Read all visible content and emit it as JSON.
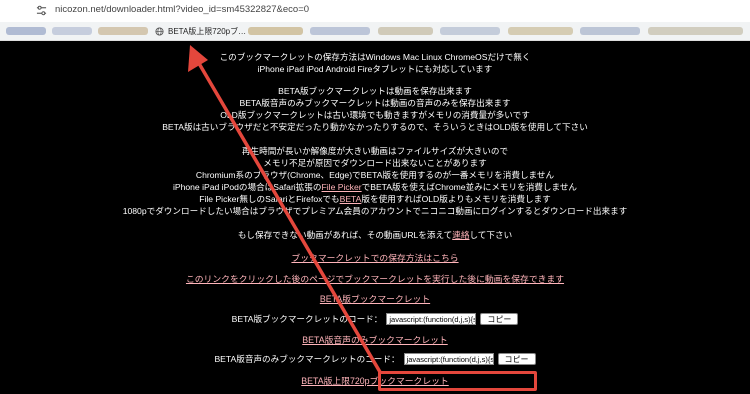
{
  "browser": {
    "url": "nicozon.net/downloader.html?video_id=sm45322827&eco=0",
    "active_bookmark": "BETA版上限720pブ…"
  },
  "page": {
    "intro": [
      "このブックマークレットの保存方法はWindows Mac Linux ChromeOSだけで無く",
      "iPhone iPad iPod Android Fireタブレットにも対応しています"
    ],
    "versions": [
      "BETA版ブックマークレットは動画を保存出来ます",
      "BETA版音声のみブックマークレットは動画の音声のみを保存出来ます",
      "OLD版ブックマークレットは古い環境でも動きますがメモリの消費量が多いです",
      "BETA版は古いブラウザだと不安定だったり動かなかったりするので、そういうときはOLD版を使用して下さい"
    ],
    "notes": [
      "再生時間が長いか解像度が大きい動画はファイルサイズが大きいので",
      "メモリ不足が原因でダウンロード出来ないことがあります",
      "Chromium系のブラウザ(Chrome、Edge)でBETA版を使用するのが一番メモリを消費しません"
    ],
    "iphone_note": {
      "before": "iPhone iPad iPodの場合はSafari拡張の",
      "link": "File Picker",
      "after": "でBETA版を使えばChrome並みにメモリを消費しません"
    },
    "filepicker_note": {
      "before": "File Picker無しのSafariとFirefoxでも",
      "link": "BETA",
      "after": "版を使用すればOLD版よりもメモリを消費します"
    },
    "premium_note": "1080pでダウンロードしたい場合はブラウザでプレミアム会員のアカウントでニコニコ動画にログインするとダウンロード出来ます",
    "report_note": {
      "before": "もし保存できない動画があれば、その動画URLを添えて",
      "link": "連絡",
      "after": "して下さい"
    },
    "link_howto": "ブックマークレットでの保存方法はこちら",
    "link_click": "このリンクをクリックした後のページでブックマークレットを実行した後に動画を保存できます",
    "link_beta": "BETA版ブックマークレット",
    "beta_code_label": "BETA版ブックマークレットのコード：",
    "beta_code_value": "javascript:(function(d,j,s){s=d",
    "copy_label": "コピー",
    "link_audio": "BETA版音声のみブックマークレット",
    "audio_code_label": "BETA版音声のみブックマークレットのコード：",
    "audio_code_value": "javascript:(function(d,j,s){s=d",
    "link_720p": "BETA版上限720pブックマークレット"
  },
  "colors": {
    "background": "#000000",
    "link": "#ffb4ba",
    "annotation": "#e4473c"
  }
}
